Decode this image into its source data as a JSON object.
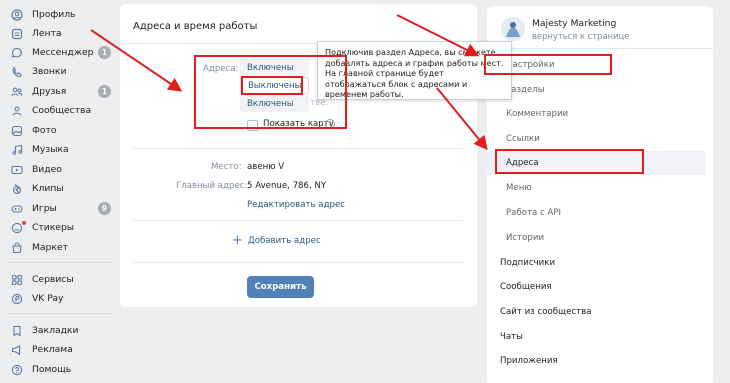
{
  "left_nav": {
    "items": [
      {
        "label": "Профиль",
        "icon": "profile-icon"
      },
      {
        "label": "Лента",
        "icon": "news-icon"
      },
      {
        "label": "Мессенджер",
        "icon": "messenger-icon",
        "badge": "1"
      },
      {
        "label": "Звонки",
        "icon": "phone-icon"
      },
      {
        "label": "Друзья",
        "icon": "friends-icon",
        "badge": "1"
      },
      {
        "label": "Сообщества",
        "icon": "communities-icon"
      },
      {
        "label": "Фото",
        "icon": "photo-icon"
      },
      {
        "label": "Музыка",
        "icon": "music-icon"
      },
      {
        "label": "Видео",
        "icon": "video-icon"
      },
      {
        "label": "Клипы",
        "icon": "clips-icon"
      },
      {
        "label": "Игры",
        "icon": "games-icon",
        "badge": "9"
      },
      {
        "label": "Стикеры",
        "icon": "stickers-icon"
      },
      {
        "label": "Маркет",
        "icon": "market-icon"
      },
      {
        "label": "Сервисы",
        "icon": "services-icon"
      },
      {
        "label": "VK Pay",
        "icon": "vkpay-icon"
      },
      {
        "label": "Закладки",
        "icon": "bookmarks-icon"
      },
      {
        "label": "Реклама",
        "icon": "ads-icon"
      },
      {
        "label": "Помощь",
        "icon": "help-icon"
      }
    ]
  },
  "main": {
    "title": "Адреса и время работы",
    "addresses_label": "Адреса:",
    "dropdown_options": [
      "Включены",
      "Выключены",
      "Включены"
    ],
    "faded_text": "тве.",
    "show_map_label": "Показать карту",
    "help_mark": "?",
    "place_label": "Место:",
    "place_value": "авеню V",
    "main_address_label": "Главный адрес:",
    "main_address_value": "5 Avenue, 786, NY",
    "edit_address_link": "Редактировать адрес",
    "add_address_label": "Добавить адрес",
    "save_button": "Сохранить"
  },
  "tooltip": {
    "text": "Подключив раздел Адреса, вы сможете добавлять адреса и график работы мест. На главной странице будет отображаться блок с адресами и временем работы."
  },
  "right_panel": {
    "group_name": "Majesty Marketing",
    "back_link": "вернуться к странице",
    "sub_items": [
      "Настройки",
      "Разделы",
      "Комментарии",
      "Ссылки",
      "Адреса",
      "Меню",
      "Работа с API",
      "Истории"
    ],
    "top_items": [
      "Подписчики",
      "Сообщения",
      "Сайт из сообщества",
      "Чаты",
      "Приложения"
    ]
  },
  "colors": {
    "accent": "#5181b8",
    "link": "#2a5885",
    "annotation": "#e01e1e",
    "background": "#edeef0"
  }
}
